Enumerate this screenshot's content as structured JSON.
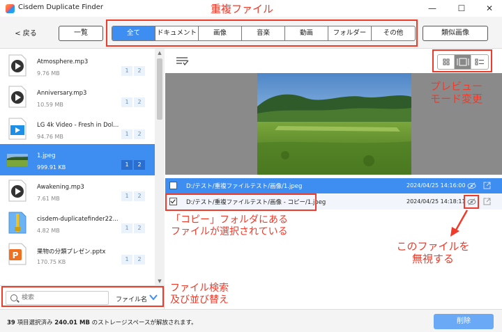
{
  "window": {
    "title": "Cisdem Duplicate Finder",
    "minimize": "—",
    "maximize": "☐",
    "close": "✕"
  },
  "toolbar": {
    "back_label": "< 戻る",
    "list_label": "一覧",
    "similar_label": "類似画像",
    "tabs": [
      {
        "label": "全て",
        "active": true
      },
      {
        "label": "ドキュメント",
        "active": false
      },
      {
        "label": "画像",
        "active": false
      },
      {
        "label": "音楽",
        "active": false
      },
      {
        "label": "動画",
        "active": false
      },
      {
        "label": "フォルダー",
        "active": false
      },
      {
        "label": "その他",
        "active": false
      }
    ]
  },
  "annotations": {
    "tabs_caption": "重複ファイル",
    "preview_mode_caption_line1": "プレビュー",
    "preview_mode_caption_line2": "モード変更",
    "copy_caption_line1": "「コピー」フォルダにある",
    "copy_caption_line2": "ファイルが選択されている",
    "ignore_caption_line1": "このファイルを",
    "ignore_caption_line2": "無視する",
    "search_caption_line1": "ファイル検索",
    "search_caption_line2": "及び並び替え"
  },
  "file_list": [
    {
      "name": "Atmosphere.mp3",
      "size": "9.76 MB",
      "c1": "1",
      "c2": "2",
      "type": "audio",
      "selected": false
    },
    {
      "name": "Anniversary.mp3",
      "size": "10.59 MB",
      "c1": "1",
      "c2": "2",
      "type": "audio",
      "selected": false
    },
    {
      "name": "LG 4k Video - Fresh in Dol...",
      "size": "94.76 MB",
      "c1": "1",
      "c2": "2",
      "type": "video",
      "selected": false
    },
    {
      "name": "1.jpeg",
      "size": "999.91 KB",
      "c1": "1",
      "c2": "2",
      "type": "image",
      "selected": true
    },
    {
      "name": "Awakening.mp3",
      "size": "7.61 MB",
      "c1": "1",
      "c2": "2",
      "type": "audio",
      "selected": false
    },
    {
      "name": "cisdem-duplicatefinder22...",
      "size": "4.82 MB",
      "c1": "1",
      "c2": "2",
      "type": "archive",
      "selected": false
    },
    {
      "name": "果物の分類プレゼン.pptx",
      "size": "170.75 KB",
      "c1": "1",
      "c2": "2",
      "type": "pptx",
      "selected": false
    }
  ],
  "search": {
    "placeholder": "検索",
    "sort_label": "ファイル名"
  },
  "duplicates": [
    {
      "path": "D:/テスト/重複ファイルテスト/画像/1.jpeg",
      "date": "2024/04/25 14:16:00",
      "checked": false
    },
    {
      "path": "D:/テスト/重複ファイルテスト/画像 - コピー/1.jpeg",
      "date": "2024/04/25 14:18:11",
      "checked": true
    }
  ],
  "status": {
    "count": "39",
    "count_suffix": "項目選択済み",
    "size": "240.01 MB",
    "size_suffix": "のストレージスペースが解放されます。",
    "delete_label": "削除"
  },
  "colors": {
    "accent": "#3d8ef0",
    "annotation": "#f03a2a"
  }
}
